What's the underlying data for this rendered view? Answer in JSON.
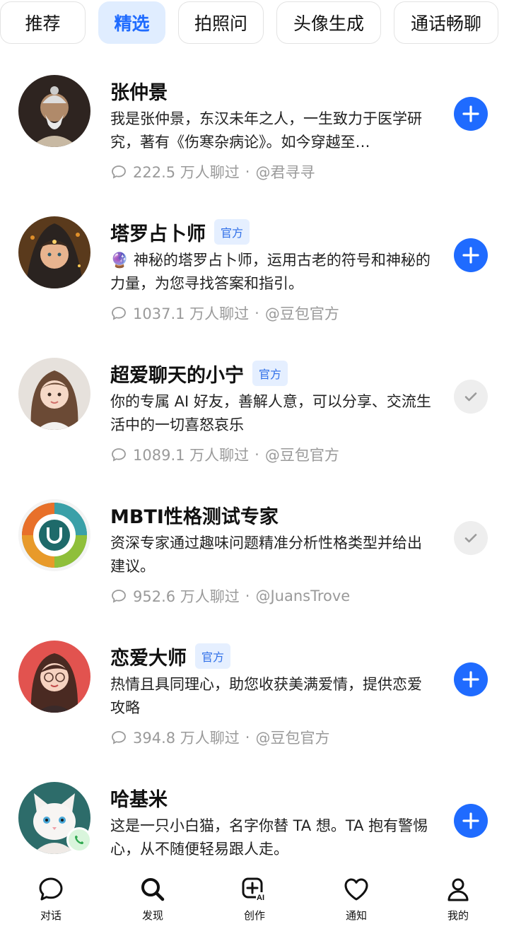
{
  "tabs": [
    {
      "label": "推荐",
      "active": false
    },
    {
      "label": "精选",
      "active": true
    },
    {
      "label": "拍照问",
      "active": false
    },
    {
      "label": "头像生成",
      "active": false
    },
    {
      "label": "通话畅聊",
      "active": false
    }
  ],
  "bots": [
    {
      "name": "张仲景",
      "badge": "",
      "description": "我是张仲景，东汉未年之人，一生致力于医学研究，著有《伤寒杂病论》。如今穿越至…",
      "chats": "222.5 万人聊过",
      "author": "@君寻寻",
      "status": "add",
      "avatar_icon": "old-sage-avatar"
    },
    {
      "name": "塔罗占卜师",
      "badge": "官方",
      "description": "🔮 神秘的塔罗占卜师，运用古老的符号和神秘的力量，为您寻找答案和指引。",
      "chats": "1037.1 万人聊过",
      "author": "@豆包官方",
      "status": "add",
      "avatar_icon": "tarot-reader-avatar"
    },
    {
      "name": "超爱聊天的小宁",
      "badge": "官方",
      "description": "你的专属 AI 好友，善解人意，可以分享、交流生活中的一切喜怒哀乐",
      "chats": "1089.1 万人聊过",
      "author": "@豆包官方",
      "status": "added",
      "avatar_icon": "girl-avatar"
    },
    {
      "name": "MBTI性格测试专家",
      "badge": "",
      "description": "资深专家通过趣味问题精准分析性格类型并给出建议。",
      "chats": "952.6 万人聊过",
      "author": "@JuansTrove",
      "status": "added",
      "avatar_icon": "mbti-wheel-avatar"
    },
    {
      "name": "恋爱大师",
      "badge": "官方",
      "description": "热情且具同理心，助您收获美满爱情，提供恋爱攻略",
      "chats": "394.8 万人聊过",
      "author": "@豆包官方",
      "status": "add",
      "avatar_icon": "glasses-girl-avatar"
    },
    {
      "name": "哈基米",
      "badge": "",
      "description": "这是一只小白猫，名字你替 TA 想。TA 抱有警惕心，从不随便轻易跟人走。",
      "chats": "",
      "author": "",
      "status": "add",
      "avatar_icon": "white-cat-avatar"
    }
  ],
  "separator": "·",
  "nav": [
    {
      "label": "对话",
      "icon": "chat-icon"
    },
    {
      "label": "发现",
      "icon": "search-icon"
    },
    {
      "label": "创作",
      "icon": "create-ai-icon"
    },
    {
      "label": "通知",
      "icon": "heart-icon"
    },
    {
      "label": "我的",
      "icon": "profile-icon"
    }
  ],
  "colors": {
    "accent": "#1f6bff",
    "badge_bg": "#e5efff",
    "muted": "#9a9a9a"
  }
}
